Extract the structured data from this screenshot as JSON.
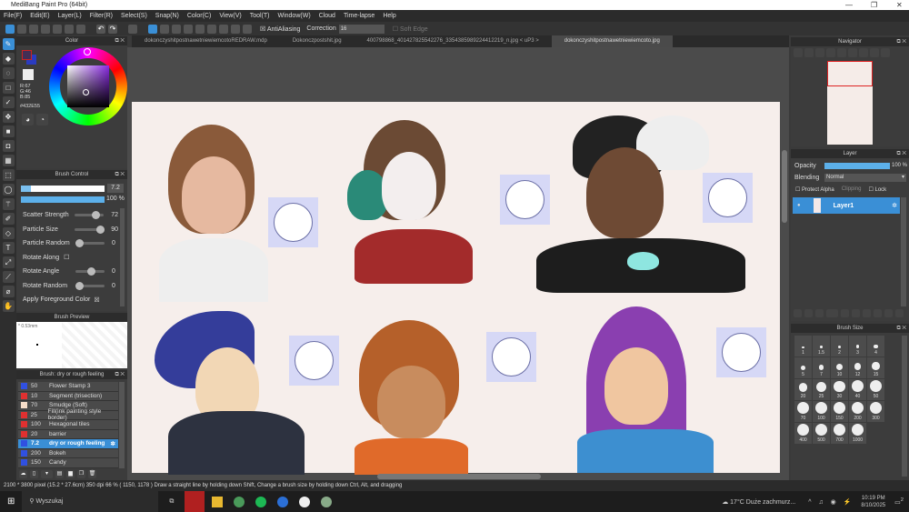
{
  "window": {
    "title": "MediBang Paint Pro (64bit)"
  },
  "menu": [
    "File(F)",
    "Edit(E)",
    "Layer(L)",
    "Filter(R)",
    "Select(S)",
    "Snap(N)",
    "Color(C)",
    "View(V)",
    "Tool(T)",
    "Window(W)",
    "Cloud",
    "Time-lapse",
    "Help"
  ],
  "toolbar": {
    "antialiasing": "AntiAliasing",
    "correction_label": "Correction",
    "correction_value": "16",
    "soft_edge": "Soft Edge"
  },
  "tabs": [
    "dokonczyshitpostnawetniewiemcotoREDRAW.mdp",
    "Dokonczpostshit.jpg",
    "400798868_401427825542276_3354385989224412219_n.jpg < uP3 >",
    "dokonczyshitpostnawetniewiemcoto.jpg"
  ],
  "color": {
    "title": "Color",
    "r": "R:67",
    "g": "G:46",
    "b": "B:85",
    "hex": "#432E55",
    "fg": "#432e55",
    "bg": "#2a3bc0"
  },
  "brush_control": {
    "title": "Brush Control",
    "size": "7.2",
    "opacity": "100 %",
    "params": [
      {
        "label": "Scatter Strength",
        "value": "72",
        "pos": 0.72
      },
      {
        "label": "Particle Size",
        "value": "90",
        "pos": 0.9
      },
      {
        "label": "Particle Random",
        "value": "0",
        "pos": 0
      },
      {
        "label": "Rotate Along",
        "checkbox": true
      },
      {
        "label": "Rotate Angle",
        "value": "0",
        "pos": 0.5
      },
      {
        "label": "Rotate Random",
        "value": "0",
        "pos": 0
      }
    ],
    "apply_fg": "Apply Foreground Color"
  },
  "brush_preview": {
    "title": "Brush Preview",
    "size": "0.53mm"
  },
  "brush_list": {
    "title": "Brush: dry or rough feeling",
    "items": [
      {
        "size": "50",
        "name": "Flower Stamp 3",
        "color": "#3050e0"
      },
      {
        "size": "10",
        "name": "Segment (trisection)",
        "color": "#e03030"
      },
      {
        "size": "70",
        "name": "Smudge (Soft)",
        "color": "#f5dcc8"
      },
      {
        "size": "25",
        "name": "Fill(ink painting style border)",
        "color": "#e03030"
      },
      {
        "size": "100",
        "name": "Hexagonal tiles",
        "color": "#e03030"
      },
      {
        "size": "20",
        "name": "barrier",
        "color": "#e03030"
      },
      {
        "size": "7.2",
        "name": "dry or rough feeling",
        "color": "#3050e0",
        "selected": true
      },
      {
        "size": "200",
        "name": "Bokeh",
        "color": "#3050e0"
      },
      {
        "size": "150",
        "name": "Candy",
        "color": "#3050e0"
      }
    ]
  },
  "navigator": {
    "title": "Navigator"
  },
  "layer": {
    "title": "Layer",
    "opacity_label": "Opacity",
    "opacity": "100 %",
    "blending_label": "Blending",
    "blending": "Normal",
    "protect_alpha": "Protect Alpha",
    "clipping": "Clipping",
    "lock": "Lock",
    "layers": [
      "Layer1"
    ]
  },
  "brush_size": {
    "title": "Brush Size",
    "sizes": [
      "1",
      "1.5",
      "2",
      "3",
      "4",
      "5",
      "7",
      "10",
      "12",
      "15",
      "20",
      "25",
      "30",
      "40",
      "50",
      "70",
      "100",
      "150",
      "200",
      "300",
      "400",
      "500",
      "700",
      "1000"
    ]
  },
  "status": "2100 * 3800 pixel  (15.2 * 27.6cm)  350 dpi  66 %  ( 1150, 1178 )  Draw a straight line by holding down Shift, Change a brush size by holding down Ctrl, Alt, and dragging",
  "taskbar": {
    "search": "Wyszukaj",
    "weather": "17°C  Duże zachmurz...",
    "time": "10:19 PM",
    "date": "8/10/2025",
    "notif": "2"
  }
}
